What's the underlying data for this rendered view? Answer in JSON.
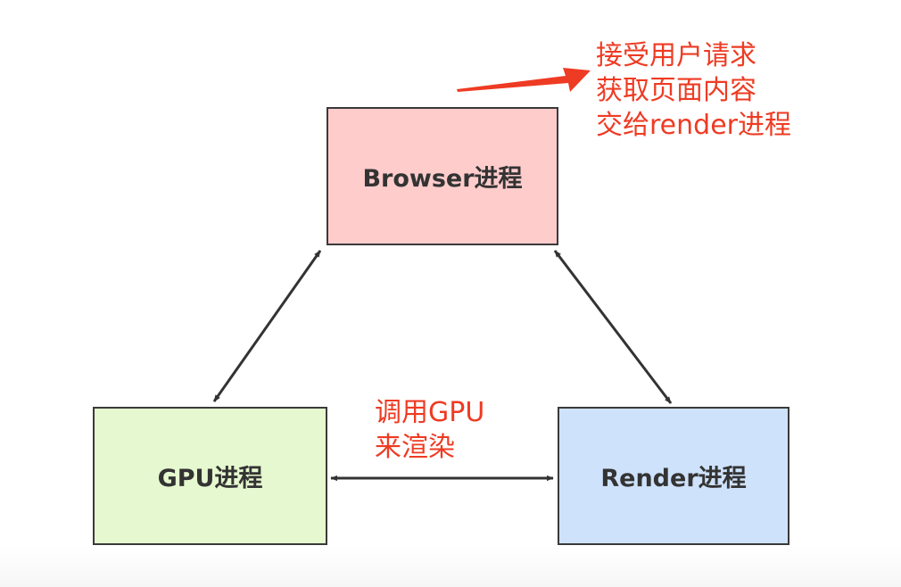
{
  "nodes": {
    "browser": "Browser进程",
    "gpu": "GPU进程",
    "render": "Render进程"
  },
  "annotations": {
    "browser": [
      "接受用户请求",
      "获取页面内容",
      "交给render进程"
    ],
    "gpu_render": [
      "调用GPU",
      "来渲染"
    ]
  },
  "colors": {
    "browser_fill": "#ffcccc",
    "gpu_fill": "#e6f8cf",
    "render_fill": "#cfe2fb",
    "annotation_text": "#ee3b23",
    "node_border": "#3a3a3a"
  }
}
